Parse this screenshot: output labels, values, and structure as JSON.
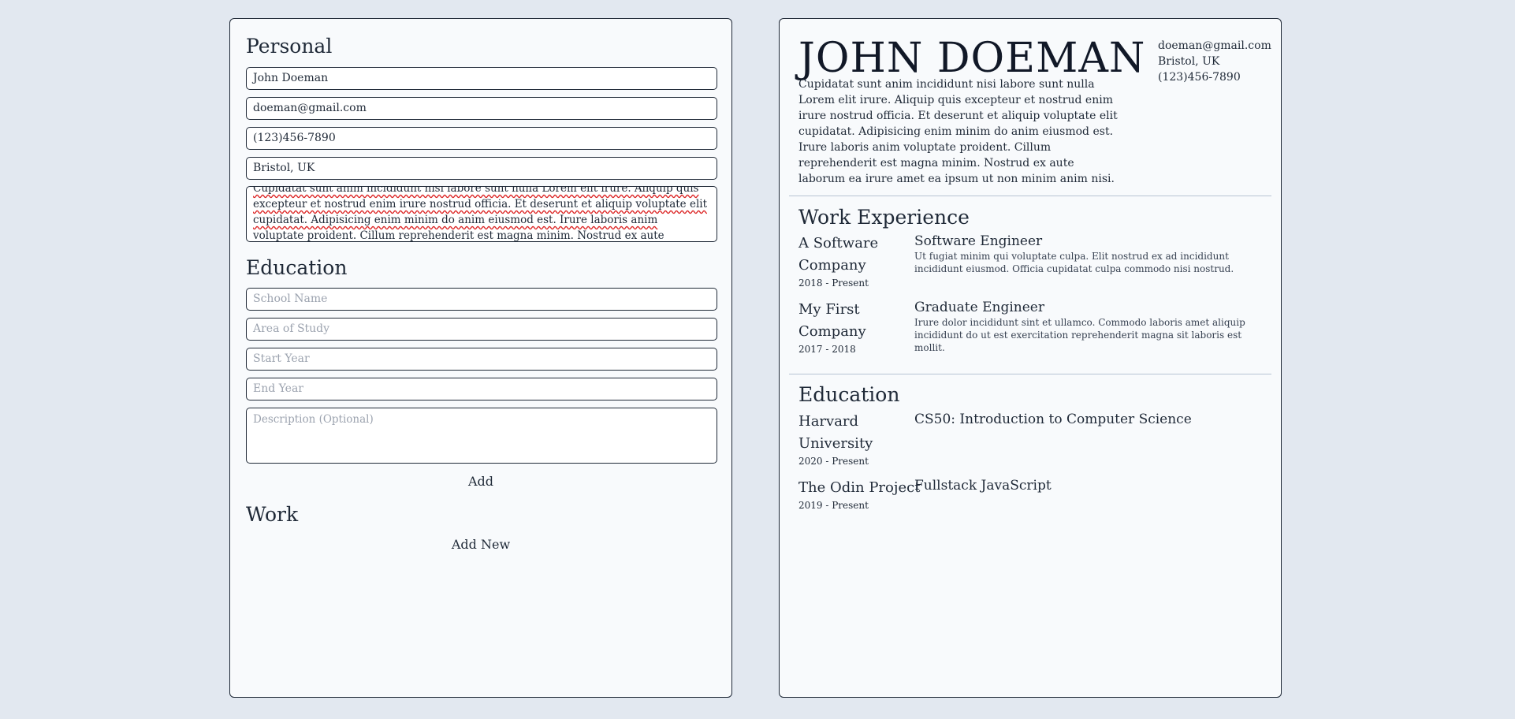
{
  "editor": {
    "personal_title": "Personal",
    "name_value": "John Doeman",
    "email_value": "doeman@gmail.com",
    "phone_value": "(123)456-7890",
    "location_value": "Bristol, UK",
    "about_text": "Cupidatat sunt anim incididunt nisi labore sunt nulla Lorem elit irure. Aliquip quis excepteur et nostrud enim irure nostrud officia. Et deserunt et aliquip voluptate elit cupidatat. Adipisicing enim minim do anim eiusmod est. Irure laboris anim voluptate proident. Cillum reprehenderit est magna minim. Nostrud ex aute laborum ea irure amet",
    "education_title": "Education",
    "school_placeholder": "School Name",
    "study_placeholder": "Area of Study",
    "start_placeholder": "Start Year",
    "end_placeholder": "End Year",
    "desc_placeholder": "Description (Optional)",
    "add_label": "Add",
    "work_title": "Work",
    "add_new_label": "Add New"
  },
  "resume": {
    "name": "JOHN DOEMAN",
    "about": "Cupidatat sunt anim incididunt nisi labore sunt nulla Lorem elit irure. Aliquip quis excepteur et nostrud enim irure nostrud officia. Et deserunt et aliquip voluptate elit cupidatat. Adipisicing enim minim do anim eiusmod est. Irure laboris anim voluptate proident. Cillum reprehenderit est magna minim. Nostrud ex aute laborum ea irure amet ea ipsum ut non minim anim nisi.",
    "email": "doeman@gmail.com",
    "location": "Bristol, UK",
    "phone": "(123)456-7890",
    "work_title": "Work Experience",
    "jobs": [
      {
        "company": "A Software Company",
        "dates": "2018 - Present",
        "role": "Software Engineer",
        "desc": "Ut fugiat minim qui voluptate culpa. Elit nostrud ex ad incididunt incididunt eiusmod. Officia cupidatat culpa commodo nisi nostrud."
      },
      {
        "company": "My First Company",
        "dates": "2017 - 2018",
        "role": "Graduate Engineer",
        "desc": "Irure dolor incididunt sint et ullamco. Commodo laboris amet aliquip incididunt do ut est exercitation reprehenderit magna sit laboris est mollit."
      }
    ],
    "education_title": "Education",
    "schools": [
      {
        "school": "Harvard University",
        "dates": "2020 - Present",
        "course": "CS50: Introduction to Computer Science"
      },
      {
        "school": "The Odin Project",
        "dates": "2019 - Present",
        "course": "Fullstack JavaScript"
      }
    ]
  },
  "colors": {
    "background": "#e2e8f0",
    "panel": "#f8fafc",
    "border": "#1f2937",
    "divider": "#b7c3d3",
    "placeholder": "#9ca3af",
    "spellcheck": "#dc2626"
  }
}
